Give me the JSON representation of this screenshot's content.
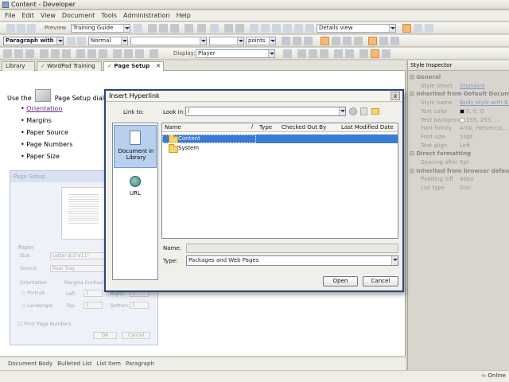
{
  "window": {
    "title": "Content - Developer"
  },
  "menu": [
    "File",
    "Edit",
    "View",
    "Document",
    "Tools",
    "Administration",
    "Help"
  ],
  "toolbar1": {
    "preview_label": "Preview",
    "guide_value": "Training Guide",
    "view_value": "Details view"
  },
  "toolbar2": {
    "paragraph_value": "Paragraph with 8 ...",
    "style_value": "Normal",
    "unit_value": "points"
  },
  "toolbar3": {
    "display_label": "Display:",
    "display_value": "Player"
  },
  "tabs": [
    {
      "label": "Library"
    },
    {
      "label": "WordPad Training"
    },
    {
      "label": "Page Setup"
    }
  ],
  "document": {
    "intro_start": "Use the",
    "intro_end": "Page Setup dialo",
    "bullets": [
      "Orientation",
      "Margins",
      "Paper Source",
      "Page Numbers",
      "Paper Size"
    ],
    "screenshot": {
      "title": "Page Setup",
      "paper_label": "Paper",
      "size_label": "Size:",
      "size_value": "Letter 8.5\"x11\"",
      "source_label": "Source:",
      "source_value": "Rear Tray",
      "orientation_label": "Orientation",
      "portrait_label": "Portrait",
      "landscape_label": "Landscape",
      "margins_label": "Margins (inches)",
      "left_label": "Left:",
      "left_value": "1",
      "right_label": "Right:",
      "right_value": "1",
      "top_label": "Top:",
      "top_value": "1",
      "bottom_label": "Bottom:",
      "bottom_value": "1",
      "print_page_numbers_label": "Print Page Numbers",
      "ok_label": "OK",
      "cancel_label": "Cancel"
    }
  },
  "breadcrumbs": [
    "Document Body",
    "Bulleted List",
    "List Item",
    "Paragraph"
  ],
  "status": {
    "online_label": "Online"
  },
  "style_inspector": {
    "title": "Style Inspector",
    "sections": [
      {
        "type": "section",
        "label": "General"
      },
      {
        "type": "row",
        "key": "Style Sheet",
        "value": "Standard",
        "link": true
      },
      {
        "type": "section",
        "label": "Inherited from Default Documen"
      },
      {
        "type": "row",
        "key": "Style name",
        "value": "Body style with 8...",
        "link": true
      },
      {
        "type": "row",
        "key": "Text color",
        "value": "0, 0, 0",
        "swatch": "#000000"
      },
      {
        "type": "row",
        "key": "Text backgrour",
        "value": "255, 255, ...",
        "swatch": "#ffffff"
      },
      {
        "type": "row",
        "key": "Font family",
        "value": "Arial, Helvetica, ..."
      },
      {
        "type": "row",
        "key": "Font size",
        "value": "10pt"
      },
      {
        "type": "row",
        "key": "Text align",
        "value": "Left"
      },
      {
        "type": "section",
        "label": "Direct formatting"
      },
      {
        "type": "row",
        "key": "Spacing after",
        "value": "6pt"
      },
      {
        "type": "section",
        "label": "Inherited from browser defaults"
      },
      {
        "type": "row",
        "key": "Padding left",
        "value": "40px"
      },
      {
        "type": "row",
        "key": "List type",
        "value": "Disc"
      }
    ]
  },
  "dialog": {
    "title": "Insert Hyperlink",
    "close_label": "x",
    "link_to_label": "Link to:",
    "look_in_label": "Look in:",
    "look_in_value": "/",
    "sources": [
      {
        "label": "Document in Library",
        "icon": "document-library-icon"
      },
      {
        "label": "URL",
        "icon": "globe-icon"
      }
    ],
    "columns": [
      "Name",
      "Type",
      "Checked Out By",
      "Last Modified Date"
    ],
    "rows": [
      {
        "name": "Content",
        "selected": true
      },
      {
        "name": "System",
        "selected": false
      }
    ],
    "name_label": "Name:",
    "name_value": "",
    "type_label": "Type:",
    "type_value": "Packages and Web Pages",
    "open_label": "Open",
    "cancel_label": "Cancel",
    "accent_color": "#3a7bd5"
  }
}
